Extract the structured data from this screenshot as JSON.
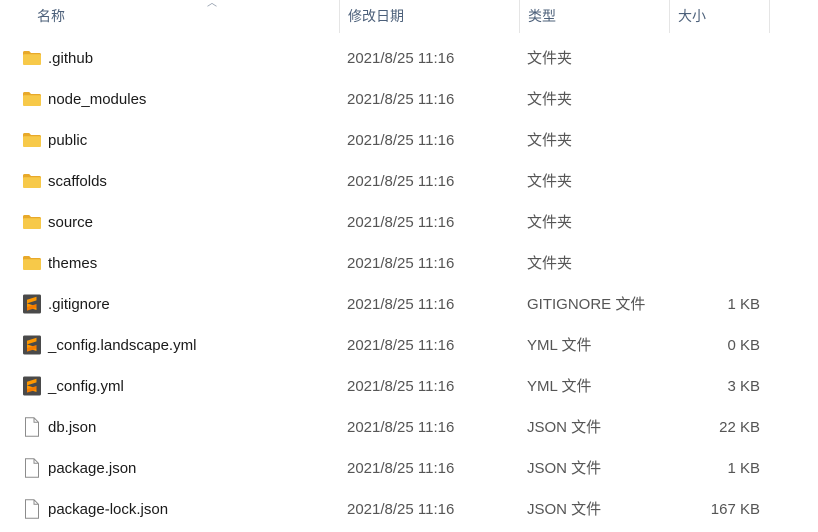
{
  "columns": {
    "name": "名称",
    "date": "修改日期",
    "type": "类型",
    "size": "大小"
  },
  "files": [
    {
      "name": ".github",
      "date": "2021/8/25 11:16",
      "type": "文件夹",
      "size": "",
      "icon": "folder-icon"
    },
    {
      "name": "node_modules",
      "date": "2021/8/25 11:16",
      "type": "文件夹",
      "size": "",
      "icon": "folder-icon"
    },
    {
      "name": "public",
      "date": "2021/8/25 11:16",
      "type": "文件夹",
      "size": "",
      "icon": "folder-icon"
    },
    {
      "name": "scaffolds",
      "date": "2021/8/25 11:16",
      "type": "文件夹",
      "size": "",
      "icon": "folder-icon"
    },
    {
      "name": "source",
      "date": "2021/8/25 11:16",
      "type": "文件夹",
      "size": "",
      "icon": "folder-icon"
    },
    {
      "name": "themes",
      "date": "2021/8/25 11:16",
      "type": "文件夹",
      "size": "",
      "icon": "folder-icon"
    },
    {
      "name": ".gitignore",
      "date": "2021/8/25 11:16",
      "type": "GITIGNORE 文件",
      "size": "1 KB",
      "icon": "sublime-file-icon"
    },
    {
      "name": "_config.landscape.yml",
      "date": "2021/8/25 11:16",
      "type": "YML 文件",
      "size": "0 KB",
      "icon": "sublime-file-icon"
    },
    {
      "name": "_config.yml",
      "date": "2021/8/25 11:16",
      "type": "YML 文件",
      "size": "3 KB",
      "icon": "sublime-file-icon"
    },
    {
      "name": "db.json",
      "date": "2021/8/25 11:16",
      "type": "JSON 文件",
      "size": "22 KB",
      "icon": "blank-file-icon"
    },
    {
      "name": "package.json",
      "date": "2021/8/25 11:16",
      "type": "JSON 文件",
      "size": "1 KB",
      "icon": "blank-file-icon"
    },
    {
      "name": "package-lock.json",
      "date": "2021/8/25 11:16",
      "type": "JSON 文件",
      "size": "167 KB",
      "icon": "blank-file-icon"
    }
  ],
  "colors": {
    "folder": "#f7c949",
    "folder_dark": "#e8a92a",
    "sublime_bg": "#4a4a4a",
    "sublime_accent": "#ff9800",
    "header_text": "#4c607a"
  }
}
